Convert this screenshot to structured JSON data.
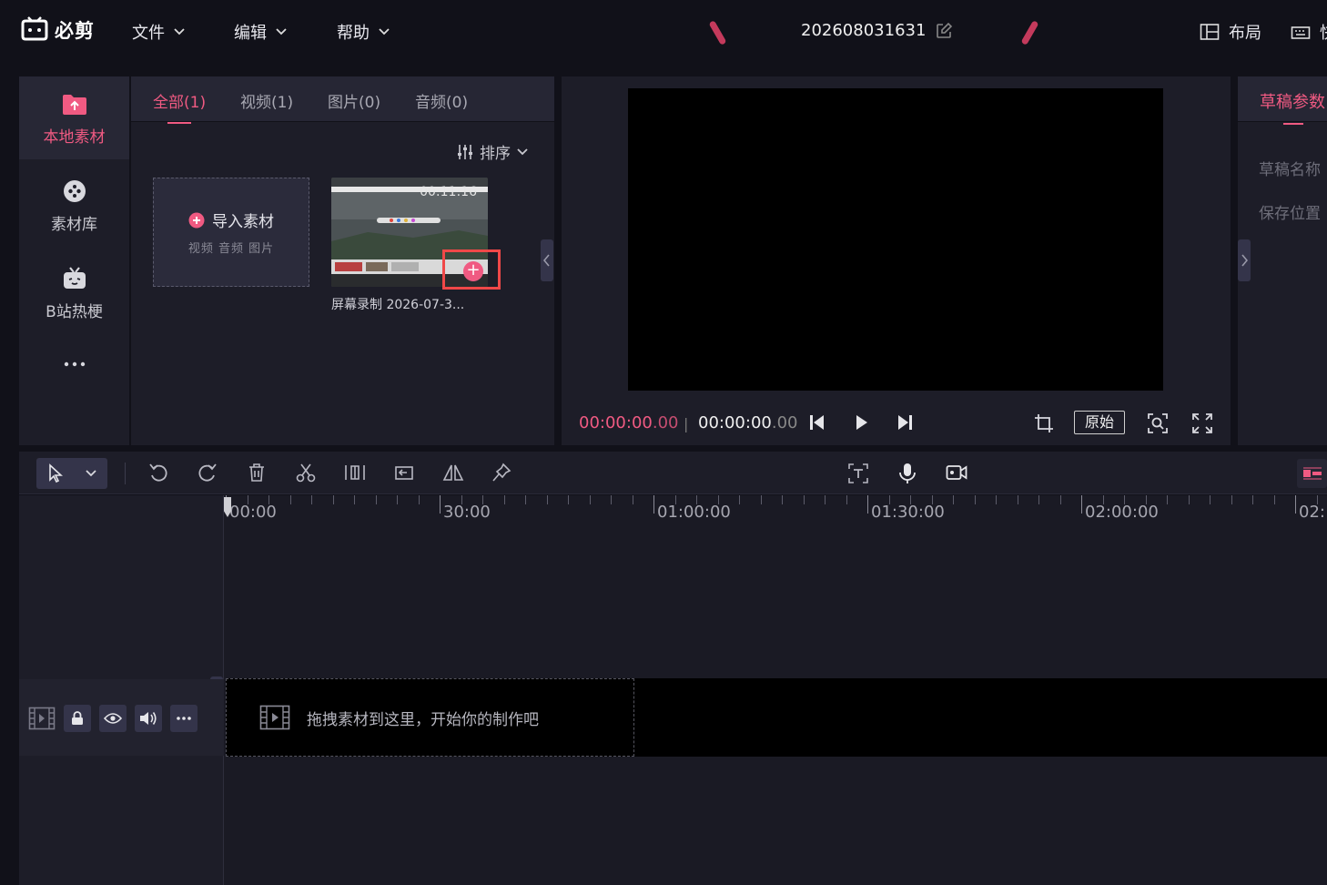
{
  "app": {
    "logo_text": "必剪",
    "menus": [
      "文件",
      "编辑",
      "帮助"
    ],
    "project_title": "202608031631",
    "right_tools": {
      "layout": "布局",
      "shortcut": "快"
    }
  },
  "sidebar": {
    "items": [
      {
        "label": "本地素材",
        "icon": "folder-upload-icon",
        "active": true
      },
      {
        "label": "素材库",
        "icon": "library-icon",
        "active": false
      },
      {
        "label": "B站热梗",
        "icon": "bilibili-tv-icon",
        "active": false
      },
      {
        "label": "···",
        "icon": "more-icon",
        "active": false
      }
    ]
  },
  "media": {
    "tabs": [
      "全部(1)",
      "视频(1)",
      "图片(0)",
      "音频(0)"
    ],
    "active_tab": 0,
    "sort_label": "排序",
    "import": {
      "label": "导入素材",
      "sub": "视频  音频  图片"
    },
    "clip": {
      "duration": "00:11:16",
      "name": "屏幕录制 2026-07-3..."
    }
  },
  "preview": {
    "current_time": "00:00:00",
    "current_frac": ".00",
    "total_time": "00:00:00",
    "total_frac": ".00",
    "original_label": "原始"
  },
  "params": {
    "tab": "草稿参数",
    "rows": [
      "草稿名称",
      "保存位置"
    ]
  },
  "timeline": {
    "ruler": [
      "00:00",
      "30:00",
      "01:00:00",
      "01:30:00",
      "02:00:00",
      "02:"
    ],
    "drop_hint": "拖拽素材到这里，开始你的制作吧"
  },
  "colors": {
    "accent": "#f05a82",
    "highlight": "#f04848",
    "panel": "#1d1d28",
    "background": "#111119"
  }
}
